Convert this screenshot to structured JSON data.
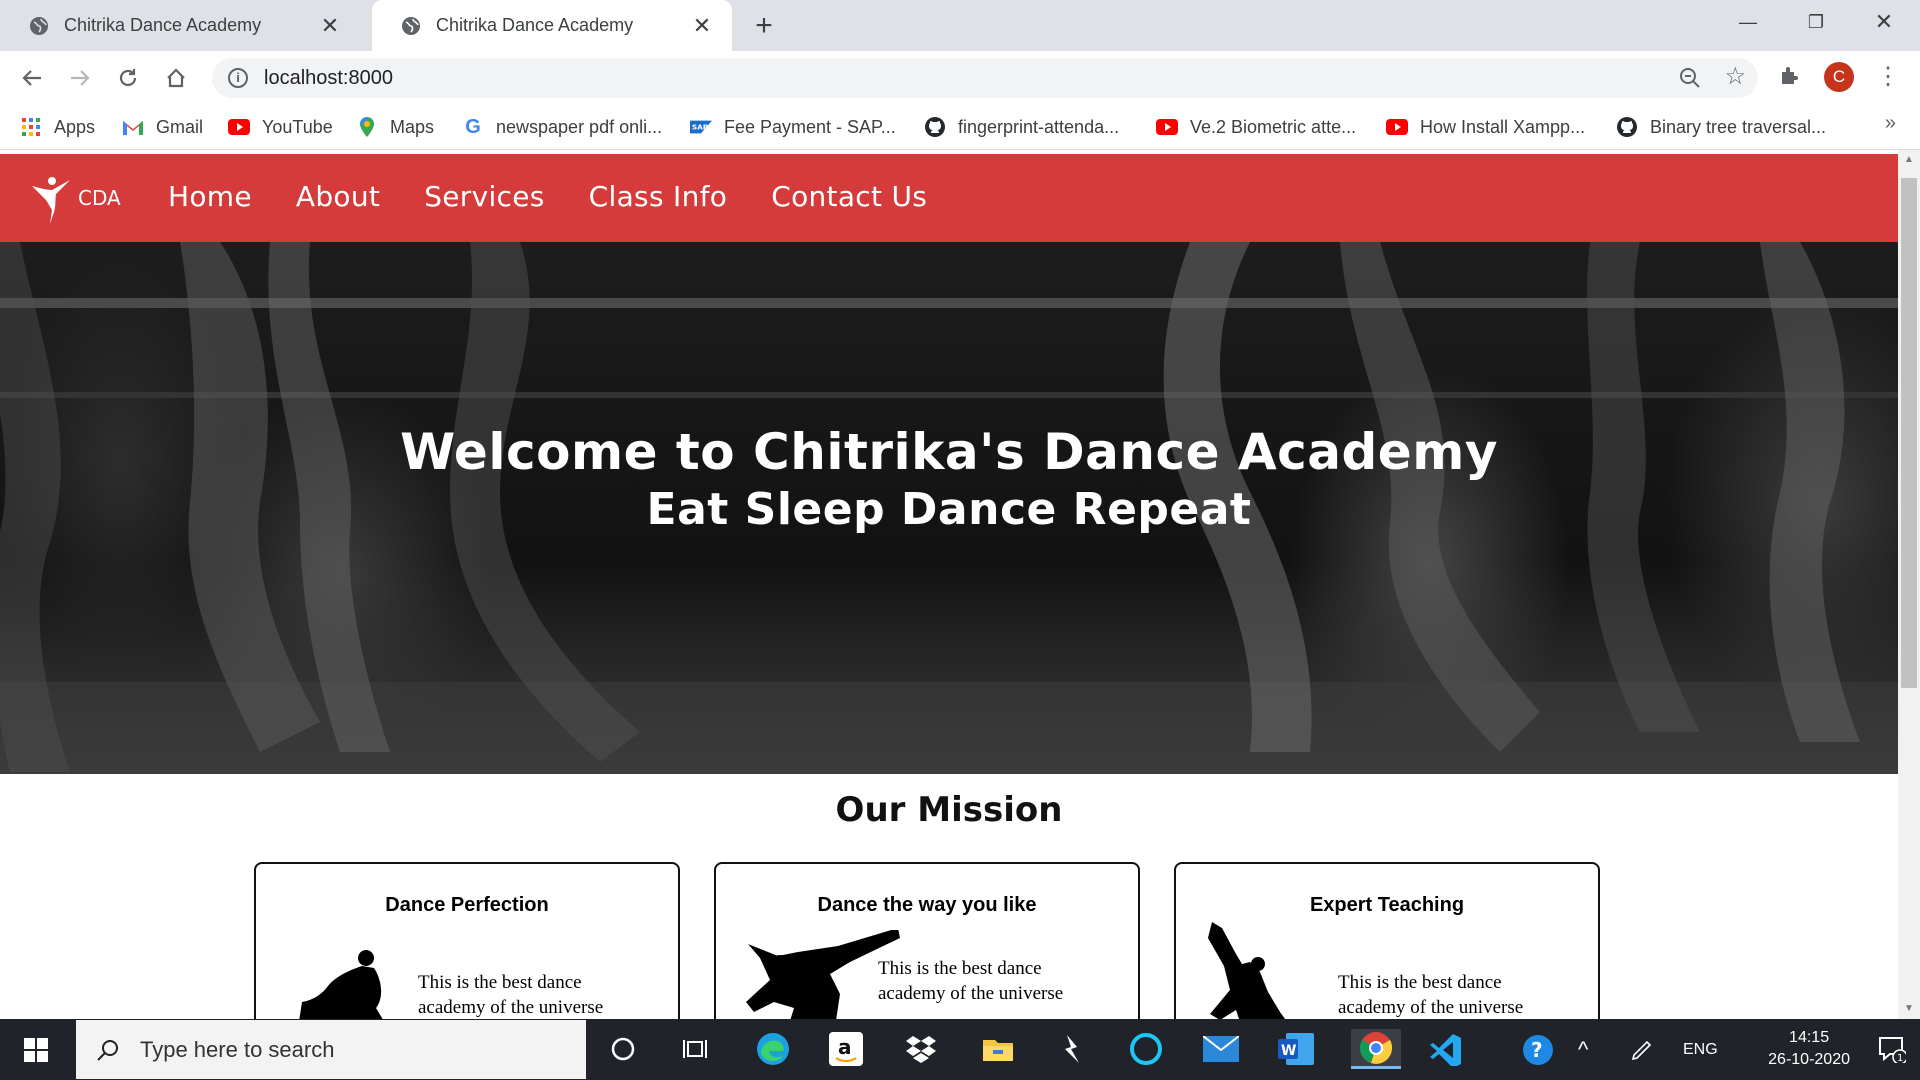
{
  "browser": {
    "tabs": [
      {
        "title": "Chitrika Dance Academy",
        "active": false
      },
      {
        "title": "Chitrika Dance Academy",
        "active": true
      }
    ],
    "url": "localhost:8000",
    "profile_initial": "C",
    "bookmarks": [
      {
        "label": "Apps",
        "icon": "apps-grid-icon"
      },
      {
        "label": "Gmail",
        "icon": "gmail-icon"
      },
      {
        "label": "YouTube",
        "icon": "youtube-icon"
      },
      {
        "label": "Maps",
        "icon": "maps-pin-icon"
      },
      {
        "label": "newspaper pdf onli...",
        "icon": "google-icon"
      },
      {
        "label": "Fee Payment - SAP...",
        "icon": "sap-icon"
      },
      {
        "label": "fingerprint-attenda...",
        "icon": "github-icon"
      },
      {
        "label": "Ve.2 Biometric atte...",
        "icon": "youtube-icon"
      },
      {
        "label": "How Install Xampp...",
        "icon": "youtube-icon"
      },
      {
        "label": "Binary tree traversal...",
        "icon": "github-icon"
      }
    ]
  },
  "site": {
    "logo_text": "CDA",
    "nav": [
      "Home",
      "About",
      "Services",
      "Class Info",
      "Contact Us"
    ],
    "hero_title": "Welcome to Chitrika's Dance Academy",
    "hero_subtitle": "Eat Sleep Dance Repeat",
    "mission_title": "Our Mission",
    "cards": [
      {
        "title": "Dance Perfection",
        "body": "This is the best dance academy of the universe"
      },
      {
        "title": "Dance the way you like",
        "body": "This is the best dance academy of the universe"
      },
      {
        "title": "Expert Teaching",
        "body": "This is the best dance academy of the universe"
      }
    ],
    "brand_color": "#d63b3b"
  },
  "taskbar": {
    "search_placeholder": "Type here to search",
    "language": "ENG",
    "time": "14:15",
    "date": "26-10-2020",
    "notification_count": "1"
  }
}
